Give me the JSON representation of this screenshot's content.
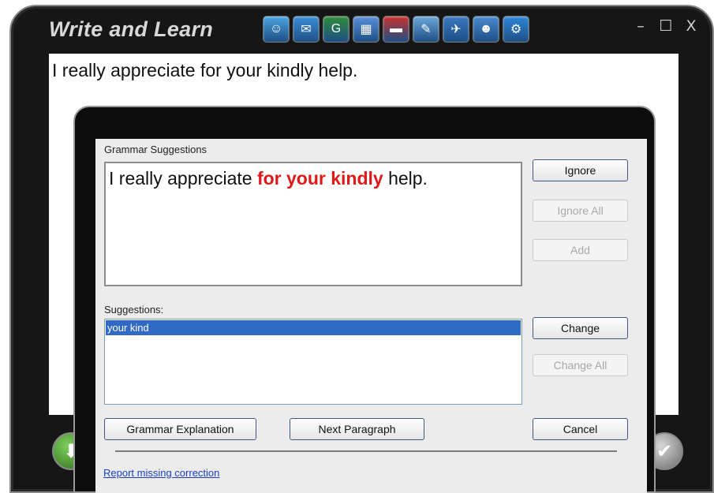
{
  "app": {
    "title": "Write and Learn",
    "window_controls": {
      "minimize": "–",
      "maximize": "☐",
      "close": "X"
    },
    "toolbar": [
      {
        "name": "chat-icon",
        "color": "#4aa3df",
        "glyph": "☺"
      },
      {
        "name": "book-open-icon",
        "color": "#3b8fd6",
        "glyph": "✉"
      },
      {
        "name": "grammar-icon",
        "color": "#2e8b3a",
        "glyph": "G"
      },
      {
        "name": "dictionary-icon",
        "color": "#5a8fd6",
        "glyph": "▦"
      },
      {
        "name": "red-book-icon",
        "color": "#c9302c",
        "glyph": "▬"
      },
      {
        "name": "spelling-icon",
        "color": "#6aa7d8",
        "glyph": "✎"
      },
      {
        "name": "translate-icon",
        "color": "#3a78c0",
        "glyph": "✈"
      },
      {
        "name": "user-icon",
        "color": "#4a89d0",
        "glyph": "☻"
      },
      {
        "name": "settings-icon",
        "color": "#2f86d8",
        "glyph": "⚙"
      }
    ]
  },
  "editor": {
    "text": "I really appreciate for your kindly help."
  },
  "dialog": {
    "grammar_label": "Grammar Suggestions",
    "sentence": {
      "before": "I really appreciate ",
      "error": "for your kindly",
      "after": " help."
    },
    "suggestions_label": "Suggestions:",
    "suggestions": [
      "your kind"
    ],
    "buttons": {
      "ignore": "Ignore",
      "ignore_all": "Ignore All",
      "add": "Add",
      "change": "Change",
      "change_all": "Change All",
      "grammar_explanation": "Grammar Explanation",
      "next_paragraph": "Next Paragraph",
      "cancel": "Cancel"
    },
    "report_link": "Report missing correction"
  }
}
